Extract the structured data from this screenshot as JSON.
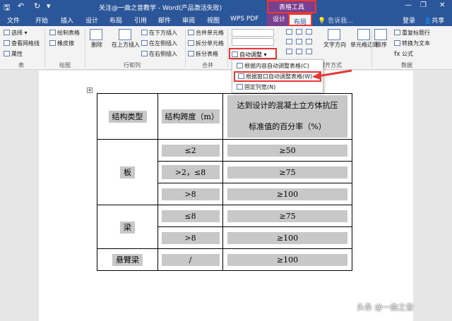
{
  "titlebar": {
    "title": "关注@一曲之音教学 - Word(产品激活失败)",
    "table_tools": "表格工具",
    "save_icon": "save-icon",
    "undo_icon": "undo-icon",
    "redo_icon": "redo-icon",
    "window_controls": [
      "minimize-icon",
      "restore-icon",
      "close-icon"
    ]
  },
  "tabs": [
    "文件",
    "开始",
    "插入",
    "设计",
    "布局",
    "引用",
    "邮件",
    "审阅",
    "视图",
    "WPS PDF"
  ],
  "context_tabs": {
    "design": "设计",
    "layout": "布局"
  },
  "tell_me": "告诉我...",
  "login": "登录",
  "share": "共享",
  "ribbon": {
    "table": {
      "select": "选择",
      "view_gridlines": "查看网格线",
      "properties": "属性",
      "group": "表"
    },
    "draw": {
      "draw_table": "绘制表格",
      "eraser": "橡皮擦",
      "group": "绘图"
    },
    "rows_cols": {
      "delete": "删除",
      "insert_above": "在上方插入",
      "insert_below": "在下方插入",
      "insert_left": "在左侧插入",
      "insert_right": "在右侧插入",
      "group": "行和列"
    },
    "merge": {
      "merge_cells": "合并单元格",
      "split_cells": "拆分单元格",
      "split_table": "拆分表格",
      "group": "合并"
    },
    "cell_size": {
      "autofit": "自动调整"
    },
    "alignment": {
      "text_direction": "文字方向",
      "cell_margins": "单元格边距",
      "group": "对齐方式"
    },
    "data": {
      "sort": "排序",
      "repeat_header": "重复标题行",
      "convert_text": "转换为文本",
      "formula": "公式",
      "group": "数据"
    }
  },
  "autofit_menu": [
    "根据内容自动调整表格(C)",
    "根据窗口自动调整表格(W)",
    "固定列宽(N)"
  ],
  "document_table": {
    "header": [
      "结构类型",
      "结构跨度（m）",
      "达到设计的混凝土立方体抗压",
      "标准值的百分率（%）"
    ],
    "rows": [
      {
        "type": "板",
        "span": "≤2",
        "pct": "≥50"
      },
      {
        "type": "",
        "span": ">2，≤8",
        "pct": "≥75"
      },
      {
        "type": "",
        "span": ">8",
        "pct": "≥100"
      },
      {
        "type": "梁",
        "span": "≤8",
        "pct": "≥75"
      },
      {
        "type": "",
        "span": ">8",
        "pct": "≥100"
      },
      {
        "type": "悬臂梁",
        "span": "/",
        "pct": "≥100"
      }
    ]
  },
  "watermark": "头条 @一曲之音",
  "accent": "#2b579a",
  "highlight": "#e53935"
}
